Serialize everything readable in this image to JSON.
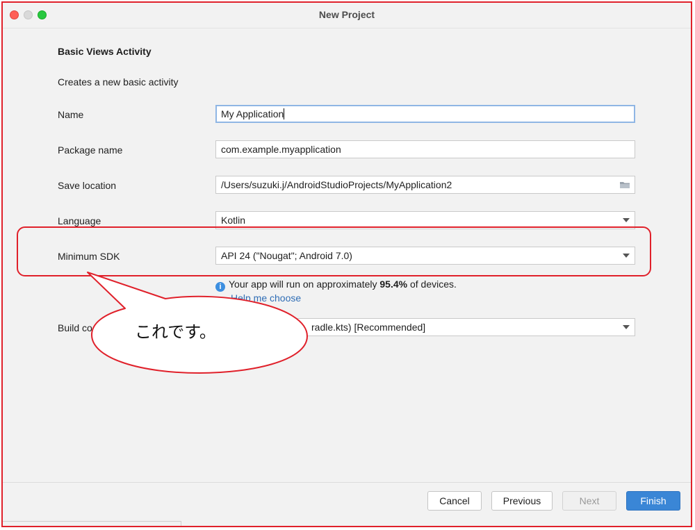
{
  "window": {
    "title": "New Project"
  },
  "template": {
    "heading": "Basic Views Activity",
    "description": "Creates a new basic activity"
  },
  "form": {
    "name": {
      "label": "Name",
      "value": "My Application"
    },
    "package": {
      "label": "Package name",
      "value": "com.example.myapplication"
    },
    "save_location": {
      "label": "Save location",
      "value": "/Users/suzuki.j/AndroidStudioProjects/MyApplication2",
      "icon": "folder-icon"
    },
    "language": {
      "label": "Language",
      "value": "Kotlin"
    },
    "min_sdk": {
      "label": "Minimum SDK",
      "value": "API 24 (\"Nougat\"; Android 7.0)"
    },
    "build_config": {
      "label_visible": "Build co",
      "value_visible": "radle.kts) [Recommended]"
    }
  },
  "info": {
    "icon": "info-icon",
    "text_before": "Your app will run on approximately ",
    "percent": "95.4%",
    "text_after": " of devices.",
    "help_link": "Help me choose"
  },
  "annotation": {
    "callout_text": "これです。",
    "color": "#e0202a"
  },
  "buttons": {
    "cancel": "Cancel",
    "previous": "Previous",
    "next": "Next",
    "finish": "Finish"
  },
  "colors": {
    "accent": "#3a86d6",
    "link": "#2f6db5",
    "focus_border": "#8fb6e4",
    "annotation_red": "#e0202a"
  }
}
